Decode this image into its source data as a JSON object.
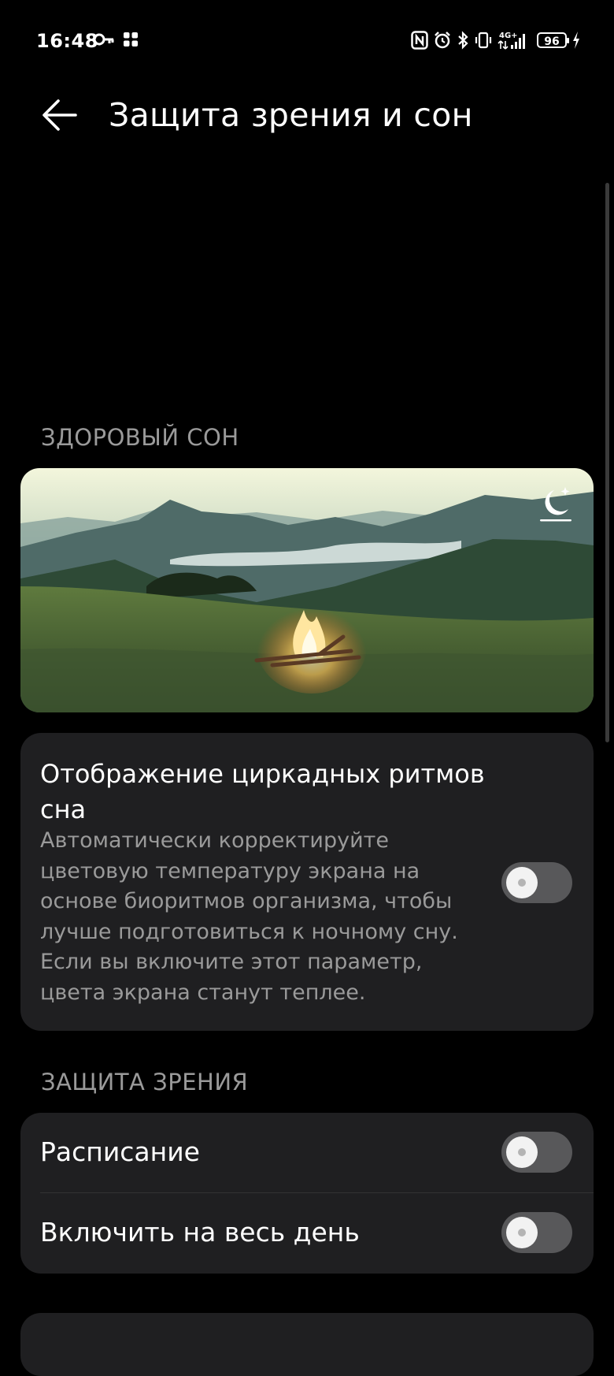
{
  "status_bar": {
    "time": "16:48",
    "left_icons": [
      "key-icon",
      "grid-apps-icon"
    ],
    "right_icons": [
      "nfc-icon",
      "alarm-icon",
      "bluetooth-icon",
      "vibrate-icon",
      "signal-4g-icon"
    ],
    "network": "4G+",
    "battery": "96"
  },
  "header": {
    "title": "Защита зрения и сон",
    "back_icon": "arrow-left-icon"
  },
  "sleep_section": {
    "header": "ЗДОРОВЫЙ СОН",
    "image_icon": "moon-stars-icon",
    "circadian": {
      "title": "Отображение циркадных ритмов сна",
      "description": "Автоматически корректируйте цветовую температуру экрана на основе биоритмов организма, чтобы лучше подготовиться к ночному сну. Если вы включите этот параметр, цвета экрана станут теплее.",
      "enabled": false
    }
  },
  "eye_section": {
    "header": "ЗАЩИТА ЗРЕНИЯ",
    "items": [
      {
        "label": "Расписание",
        "enabled": false
      },
      {
        "label": "Включить на весь день",
        "enabled": false
      }
    ]
  },
  "colors": {
    "background": "#000000",
    "card": "#1f1f21",
    "secondary_text": "#9a9a9a",
    "toggle_off": "#58585a"
  }
}
